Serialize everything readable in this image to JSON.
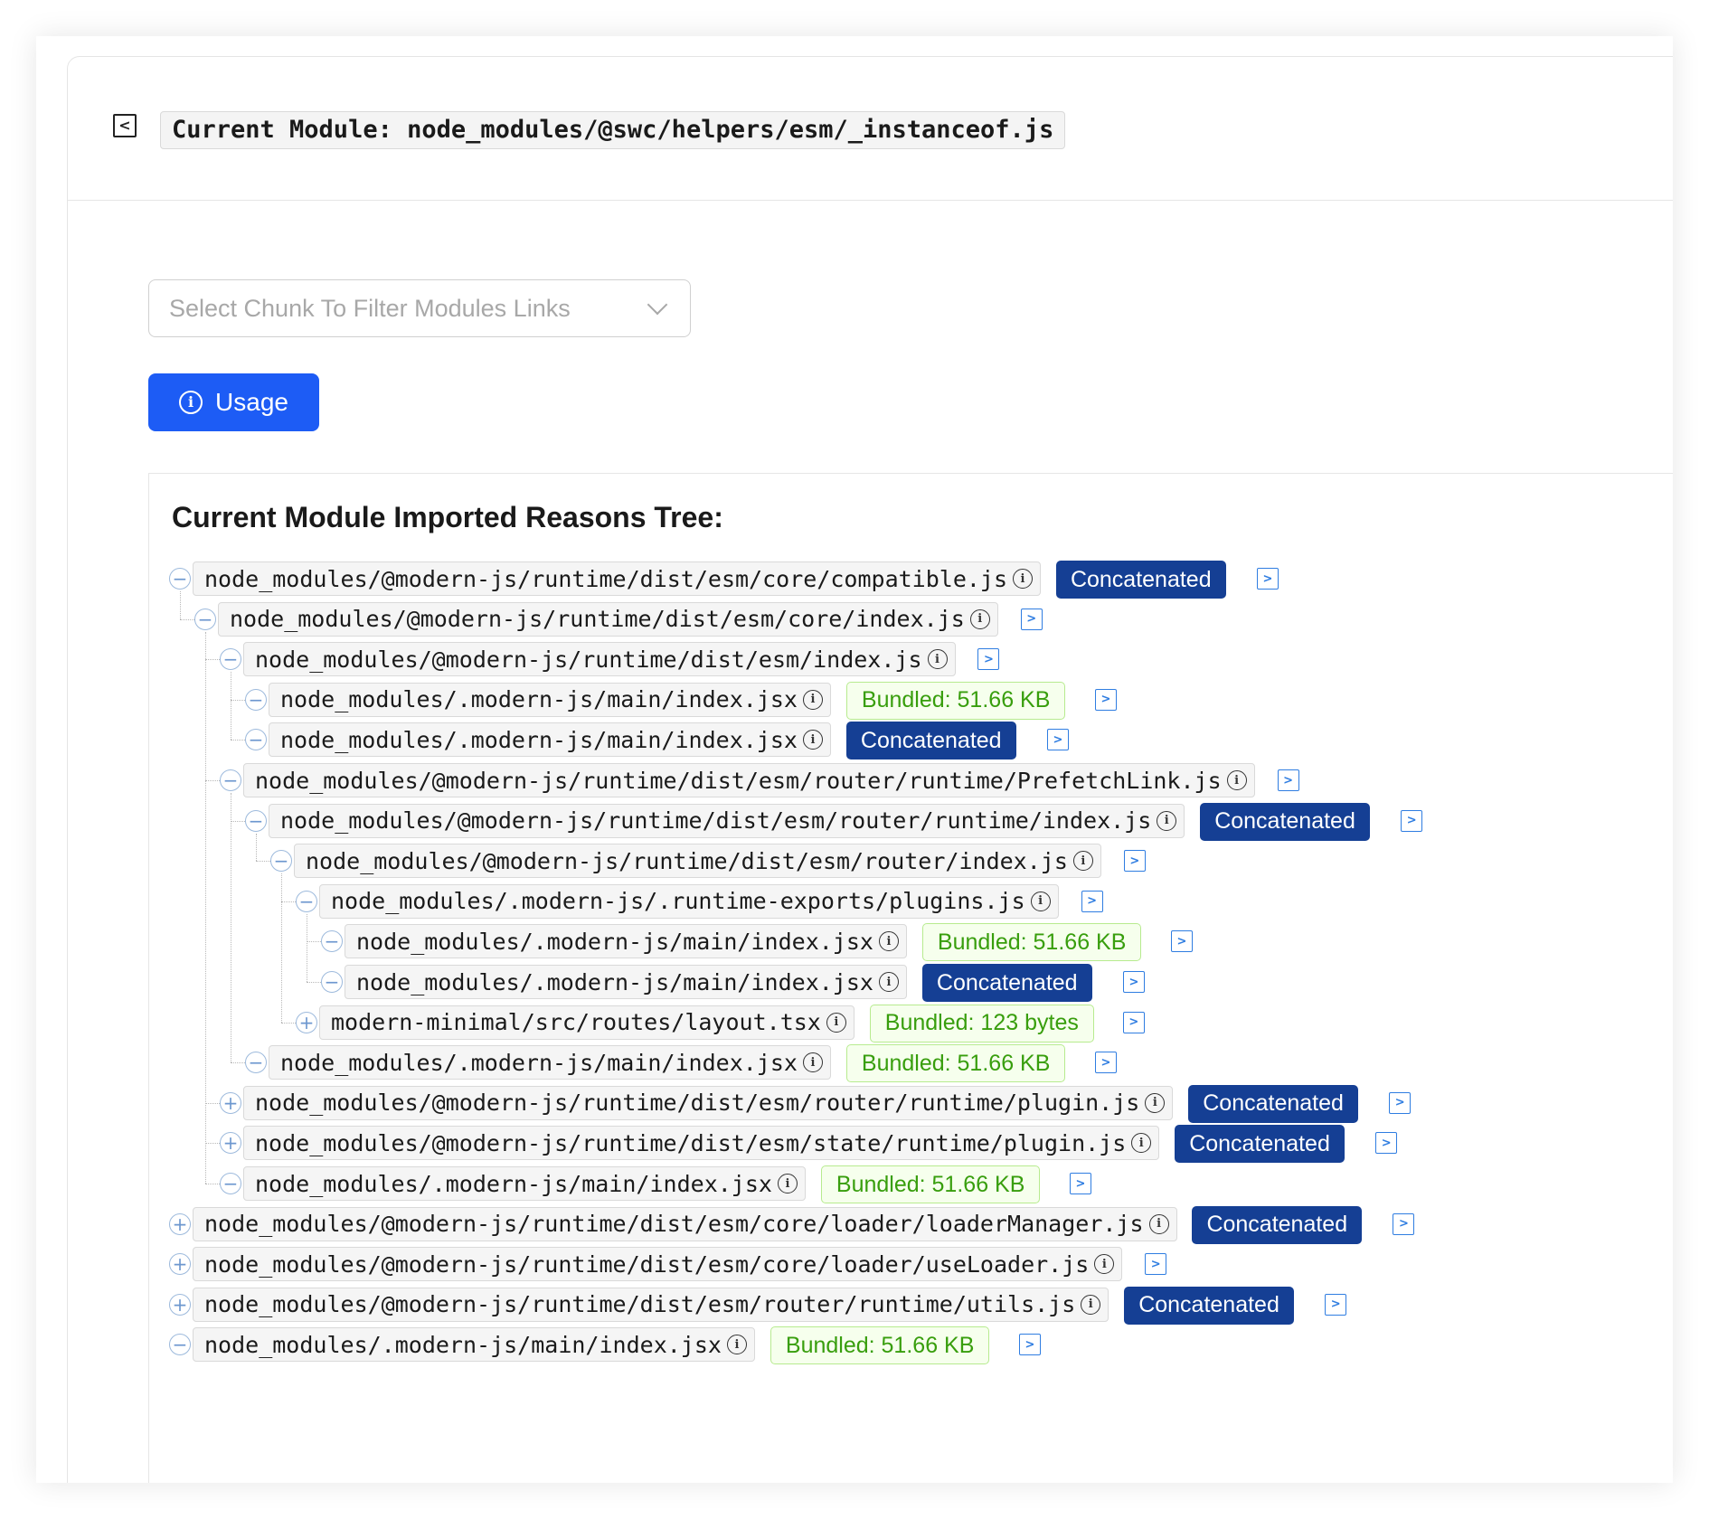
{
  "header": {
    "back_icon": "chevron-left-square-icon",
    "title": "Current Module: node_modules/@swc/helpers/esm/_instanceof.js"
  },
  "filter": {
    "placeholder": "Select Chunk To Filter Modules Links"
  },
  "usage_button": {
    "label": "Usage",
    "icon": "info-circle-icon"
  },
  "tree": {
    "title": "Current Module Imported Reasons Tree:",
    "rows": [
      {
        "depth": 0,
        "expanded": true,
        "path": "node_modules/@modern-js/runtime/dist/esm/core/compatible.js",
        "tag": "Concatenated"
      },
      {
        "depth": 1,
        "expanded": true,
        "path": "node_modules/@modern-js/runtime/dist/esm/core/index.js",
        "tag": ""
      },
      {
        "depth": 2,
        "expanded": true,
        "path": "node_modules/@modern-js/runtime/dist/esm/index.js",
        "tag": ""
      },
      {
        "depth": 3,
        "expanded": true,
        "path": "node_modules/.modern-js/main/index.jsx",
        "tag": "Bundled: 51.66 KB"
      },
      {
        "depth": 3,
        "expanded": true,
        "path": "node_modules/.modern-js/main/index.jsx",
        "tag": "Concatenated"
      },
      {
        "depth": 2,
        "expanded": true,
        "path": "node_modules/@modern-js/runtime/dist/esm/router/runtime/PrefetchLink.js",
        "tag": ""
      },
      {
        "depth": 3,
        "expanded": true,
        "path": "node_modules/@modern-js/runtime/dist/esm/router/runtime/index.js",
        "tag": "Concatenated"
      },
      {
        "depth": 4,
        "expanded": true,
        "path": "node_modules/@modern-js/runtime/dist/esm/router/index.js",
        "tag": ""
      },
      {
        "depth": 5,
        "expanded": true,
        "path": "node_modules/.modern-js/.runtime-exports/plugins.js",
        "tag": ""
      },
      {
        "depth": 6,
        "expanded": true,
        "path": "node_modules/.modern-js/main/index.jsx",
        "tag": "Bundled: 51.66 KB"
      },
      {
        "depth": 6,
        "expanded": true,
        "path": "node_modules/.modern-js/main/index.jsx",
        "tag": "Concatenated"
      },
      {
        "depth": 5,
        "expanded": false,
        "path": "modern-minimal/src/routes/layout.tsx",
        "tag": "Bundled: 123 bytes"
      },
      {
        "depth": 3,
        "expanded": true,
        "path": "node_modules/.modern-js/main/index.jsx",
        "tag": "Bundled: 51.66 KB"
      },
      {
        "depth": 2,
        "expanded": false,
        "path": "node_modules/@modern-js/runtime/dist/esm/router/runtime/plugin.js",
        "tag": "Concatenated"
      },
      {
        "depth": 2,
        "expanded": false,
        "path": "node_modules/@modern-js/runtime/dist/esm/state/runtime/plugin.js",
        "tag": "Concatenated"
      },
      {
        "depth": 2,
        "expanded": true,
        "path": "node_modules/.modern-js/main/index.jsx",
        "tag": "Bundled: 51.66 KB"
      },
      {
        "depth": 0,
        "expanded": false,
        "path": "node_modules/@modern-js/runtime/dist/esm/core/loader/loaderManager.js",
        "tag": "Concatenated"
      },
      {
        "depth": 0,
        "expanded": false,
        "path": "node_modules/@modern-js/runtime/dist/esm/core/loader/useLoader.js",
        "tag": ""
      },
      {
        "depth": 0,
        "expanded": false,
        "path": "node_modules/@modern-js/runtime/dist/esm/router/runtime/utils.js",
        "tag": "Concatenated"
      },
      {
        "depth": 0,
        "expanded": true,
        "path": "node_modules/.modern-js/main/index.jsx",
        "tag": "Bundled: 51.66 KB"
      }
    ]
  },
  "colors": {
    "primary": "#1d5cf5",
    "concatenated_tag": "#153f94",
    "bundled_tag_text": "#389e0d",
    "bundled_tag_bg": "#f6ffed",
    "jump_icon": "#2f7de1"
  }
}
